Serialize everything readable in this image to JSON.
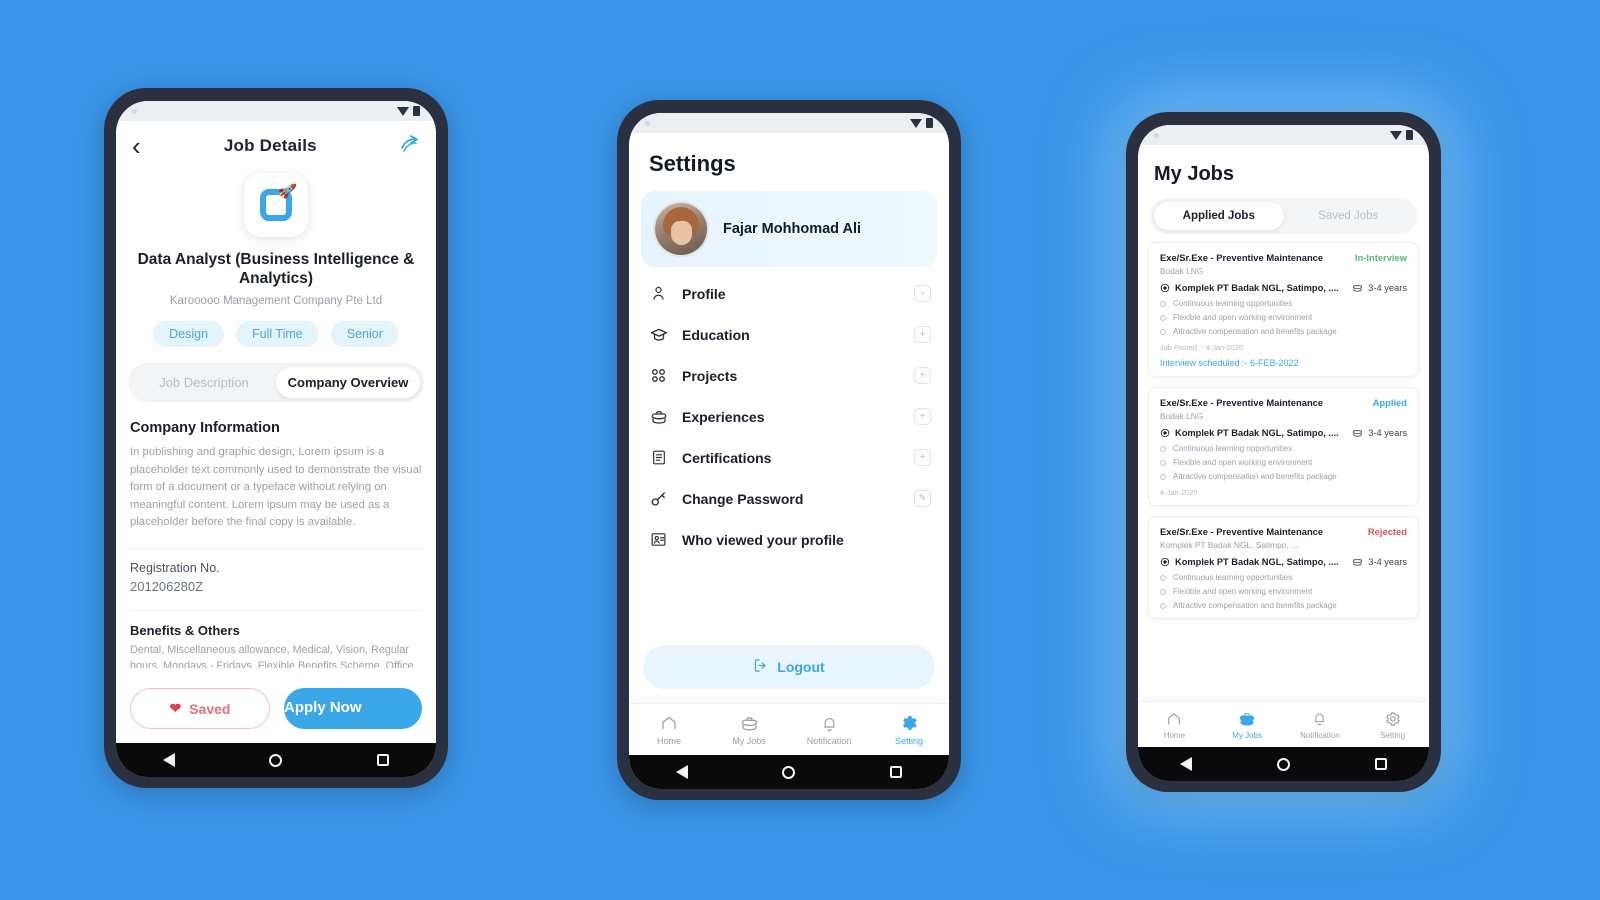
{
  "background_color": "#3a95e8",
  "phones": {
    "job_details": {
      "topbar": {
        "back_icon": "chevron-left-icon",
        "title": "Job Details",
        "share_icon": "share-icon"
      },
      "logo": {
        "icon": "app-logo-rocket",
        "accent": "#3aa7e8"
      },
      "job_title": "Data Analyst (Business Intelligence & Analytics)",
      "company": "Karooooo Management Company Pte Ltd",
      "tags": [
        "Design",
        "Full Time",
        "Senior"
      ],
      "tabs": [
        {
          "label": "Job Description",
          "active": false
        },
        {
          "label": "Company Overview",
          "active": true
        }
      ],
      "section_heading": "Company Information",
      "body_text": "In publishing and graphic design, Lorem ipsum is a placeholder text commonly used to demonstrate the visual form of a document or a typeface without relying on meaningful content. Lorem ipsum may be used as a placeholder before the final copy is available.",
      "registration_label": "Registration No.",
      "registration_value": "201206280Z",
      "benefits_heading": "Benefits & Others",
      "benefits_text": "Dental, Miscellaneous allowance, Medical, Vision, Regular hours, Mondays - Fridays, Flexible Benefits Scheme, Office",
      "saved_button": {
        "label": "Saved",
        "icon": "heart-icon",
        "color": "#e2707a"
      },
      "apply_button": {
        "label": "Apply Now",
        "color": "#3aa7e8"
      }
    },
    "settings": {
      "title": "Settings",
      "profile": {
        "name": "Fajar Mohhomad Ali",
        "avatar": "user-avatar"
      },
      "items": [
        {
          "label": "Profile",
          "icon": "person-icon",
          "action_icon": "chevron-right-icon"
        },
        {
          "label": "Education",
          "icon": "graduation-cap-icon",
          "action_icon": "plus-icon"
        },
        {
          "label": "Projects",
          "icon": "grid-icon",
          "action_icon": "plus-icon"
        },
        {
          "label": "Experiences",
          "icon": "briefcase-icon",
          "action_icon": "plus-icon"
        },
        {
          "label": "Certifications",
          "icon": "certificate-icon",
          "action_icon": "plus-icon"
        },
        {
          "label": "Change Password",
          "icon": "key-icon",
          "action_icon": "pencil-icon"
        },
        {
          "label": "Who viewed your profile",
          "icon": "profile-views-icon",
          "action_icon": ""
        }
      ],
      "logout": {
        "label": "Logout",
        "icon": "logout-icon",
        "color": "#3aa7e8"
      },
      "bottom_nav": [
        {
          "label": "Home",
          "icon": "home-icon",
          "active": false
        },
        {
          "label": "My Jobs",
          "icon": "briefcase-icon",
          "active": false
        },
        {
          "label": "Notification",
          "icon": "bell-icon",
          "active": false
        },
        {
          "label": "Setting",
          "icon": "gear-icon",
          "active": true
        }
      ]
    },
    "my_jobs": {
      "title": "My Jobs",
      "tabs": [
        {
          "label": "Applied Jobs",
          "active": true
        },
        {
          "label": "Saved Jobs",
          "active": false
        }
      ],
      "cards": [
        {
          "job_title": "Exe/Sr.Exe - Preventive Maintenance",
          "status": "In-Interview",
          "status_color": "#5bb57a",
          "subtitle": "Bodak LNG",
          "location": "Komplek PT Badak NGL, Satimpo, ....",
          "experience": "3-4 years",
          "bullets": [
            "Continuous learning opportunities",
            "Flexible and open working environment",
            "Attractive compensation and benefits package"
          ],
          "posted": "Job Posted :- 4-Jan-2020",
          "interview": "Interview scheduled :- 6-FEB-2022"
        },
        {
          "job_title": "Exe/Sr.Exe - Preventive Maintenance",
          "status": "Applied",
          "status_color": "#3aa7e8",
          "subtitle": "Bodak LNG",
          "location": "Komplek PT Badak NGL, Satimpo, ....",
          "experience": "3-4 years",
          "bullets": [
            "Continuous learning opportunities",
            "Flexible and open working environment",
            "Attractive compensation and benefits package"
          ],
          "posted": "4-Jan-2020",
          "interview": ""
        },
        {
          "job_title": "Exe/Sr.Exe - Preventive Maintenance",
          "status": "Rejected",
          "status_color": "#e0505a",
          "subtitle": "Komplek PT Badak NGL, Satimpo, ....",
          "location": "Komplek PT Badak NGL, Satimpo, ....",
          "experience": "3-4 years",
          "bullets": [
            "Continuous learning opportunities",
            "Flexible and open working environment",
            "Attractive compensation and benefits package"
          ],
          "posted": "",
          "interview": ""
        }
      ],
      "bottom_nav": [
        {
          "label": "Home",
          "icon": "home-icon",
          "active": false
        },
        {
          "label": "My Jobs",
          "icon": "briefcase-icon",
          "active": true
        },
        {
          "label": "Notification",
          "icon": "bell-icon",
          "active": false
        },
        {
          "label": "Setting",
          "icon": "gear-icon",
          "active": false
        }
      ]
    }
  }
}
